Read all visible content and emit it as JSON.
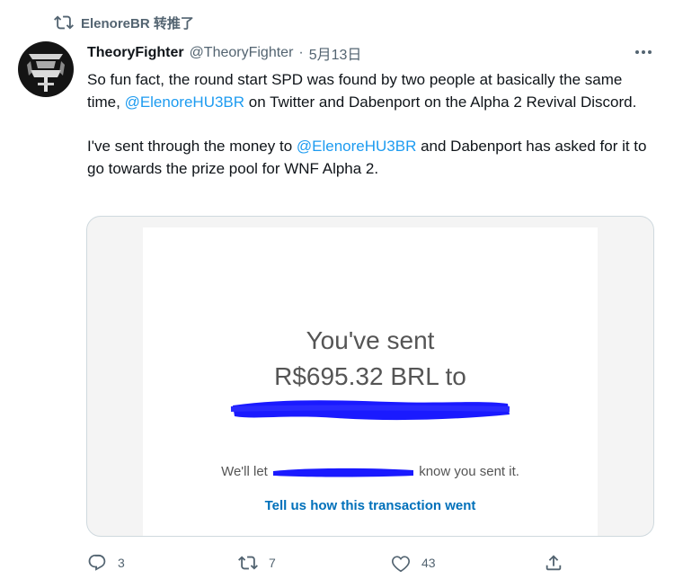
{
  "retweet": {
    "icon": "retweet-icon",
    "text": "ElenoreBR 转推了"
  },
  "author": {
    "display_name": "TheoryFighter",
    "handle": "@TheoryFighter",
    "separator": "·",
    "date": "5月13日"
  },
  "tweet": {
    "para1_before": "So fun fact, the round start SPD was found by two people at basically the same time, ",
    "para1_mention": "@ElenoreHU3BR",
    "para1_after": " on Twitter and Dabenport on the Alpha 2 Revival Discord.",
    "para2_before": "I've sent through the money to ",
    "para2_mention": "@ElenoreHU3BR",
    "para2_after": " and Dabenport has asked for it to go towards the prize pool for WNF Alpha 2."
  },
  "media": {
    "title": "You've sent",
    "amount": "R$695.32 BRL to",
    "notice_before": "We'll let",
    "notice_after": "know you sent it.",
    "link": "Tell us how this transaction went"
  },
  "actions": {
    "reply_count": "3",
    "retweet_count": "7",
    "like_count": "43"
  },
  "colors": {
    "mention": "#1d9bf0",
    "secondary_text": "#536471",
    "paypal_link": "#0070ba",
    "redaction": "#1a1aff"
  }
}
